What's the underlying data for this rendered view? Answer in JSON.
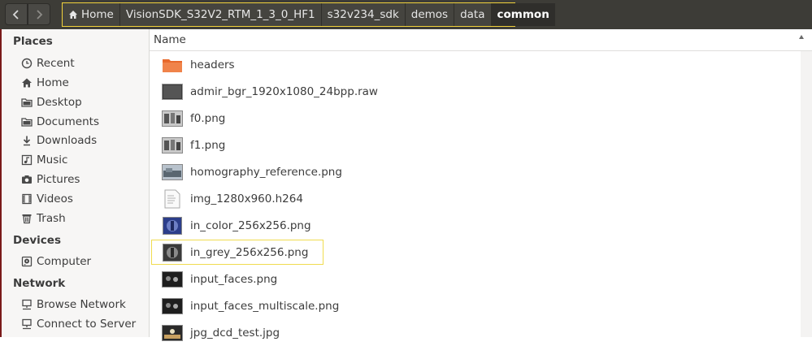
{
  "toolbar": {
    "back_icon": "chevron-left-icon",
    "forward_icon": "chevron-right-icon",
    "breadcrumb": [
      {
        "label": "Home",
        "icon": "home-icon"
      },
      {
        "label": "VisionSDK_S32V2_RTM_1_3_0_HF1"
      },
      {
        "label": "s32v234_sdk"
      },
      {
        "label": "demos"
      },
      {
        "label": "data"
      },
      {
        "label": "common",
        "active": true
      }
    ]
  },
  "sidebar": {
    "sections": [
      {
        "title": "Places",
        "items": [
          {
            "label": "Recent",
            "icon": "clock-icon"
          },
          {
            "label": "Home",
            "icon": "home-icon"
          },
          {
            "label": "Desktop",
            "icon": "folder-icon"
          },
          {
            "label": "Documents",
            "icon": "folder-icon"
          },
          {
            "label": "Downloads",
            "icon": "download-icon"
          },
          {
            "label": "Music",
            "icon": "music-icon"
          },
          {
            "label": "Pictures",
            "icon": "camera-icon"
          },
          {
            "label": "Videos",
            "icon": "film-icon"
          },
          {
            "label": "Trash",
            "icon": "trash-icon"
          }
        ]
      },
      {
        "title": "Devices",
        "items": [
          {
            "label": "Computer",
            "icon": "drive-icon"
          }
        ]
      },
      {
        "title": "Network",
        "items": [
          {
            "label": "Browse Network",
            "icon": "network-icon"
          },
          {
            "label": "Connect to Server",
            "icon": "server-icon"
          }
        ]
      }
    ]
  },
  "list": {
    "column_name": "Name",
    "sort": "ascending",
    "files": [
      {
        "name": "headers",
        "type": "folder"
      },
      {
        "name": "admir_bgr_1920x1080_24bpp.raw",
        "type": "raw"
      },
      {
        "name": "f0.png",
        "type": "image"
      },
      {
        "name": "f1.png",
        "type": "image"
      },
      {
        "name": "homography_reference.png",
        "type": "image"
      },
      {
        "name": "img_1280x960.h264",
        "type": "text"
      },
      {
        "name": "in_color_256x256.png",
        "type": "image"
      },
      {
        "name": "in_grey_256x256.png",
        "type": "image",
        "highlighted": true
      },
      {
        "name": "input_faces.png",
        "type": "image"
      },
      {
        "name": "input_faces_multiscale.png",
        "type": "image"
      },
      {
        "name": "jpg_dcd_test.jpg",
        "type": "image"
      }
    ]
  },
  "colors": {
    "toolbar_bg": "#3d3c37",
    "highlight_border": "#f2d23c",
    "folder_orange": "#e8692c"
  }
}
